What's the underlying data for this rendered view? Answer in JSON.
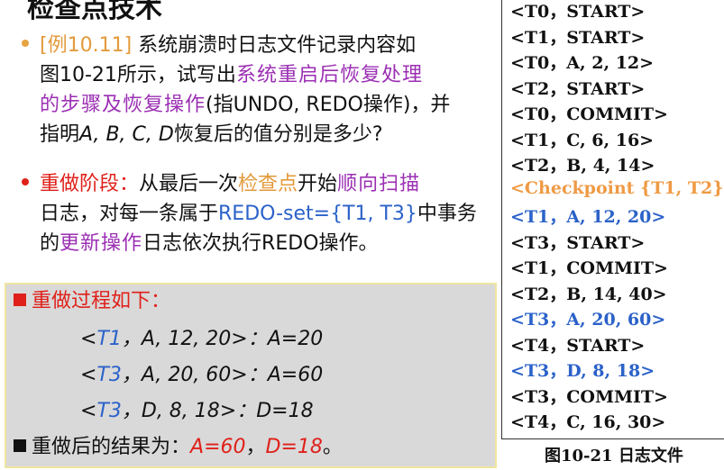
{
  "title": "检查点技术",
  "bullet1": {
    "tag": "[例10.11]",
    "line1": " 系统崩溃时日志文件记录内容如",
    "line2a": "图10-21所示，试写出",
    "line2b": "系统重启后恢复处理",
    "line3a": "的步骤及恢复操作",
    "line3b": "(指UNDO, REDO操作)，并",
    "line4a": "指明",
    "line4b": "A, B, C, D",
    "line4c": "恢复后的值分别是多少?"
  },
  "bullet2": {
    "phase": "重做阶段：",
    "l1a": "从最后一次",
    "l1b": "检查点",
    "l1c": "开始",
    "l1d": "顺向扫描",
    "l2a": "日志，对每一条属于",
    "l2b": "REDO-set={T1, T3}",
    "l2c": "中事务",
    "l3a": "的",
    "l3b": "更新操作",
    "l3c": "日志依次执行REDO操作。"
  },
  "redo_box": {
    "heading": "重做过程如下：",
    "steps": [
      {
        "tx": "T1",
        "rest": "，A, 12, 20>：",
        "result": "A=20"
      },
      {
        "tx": "T3",
        "rest": "，A, 20, 60>：",
        "result": "A=60"
      },
      {
        "tx": "T3",
        "rest": "，D, 8, 18>：",
        "result": "D=18"
      }
    ],
    "result_label": "重做后的结果为：",
    "result_a": "A=60",
    "result_sep": "，",
    "result_d": "D=18",
    "result_end": "。"
  },
  "log": [
    {
      "text": "<T0，START>",
      "color": "black"
    },
    {
      "text": "<T1，START>",
      "color": "black"
    },
    {
      "text": "<T0，A, 2, 12>",
      "color": "black"
    },
    {
      "text": "<T2，START>",
      "color": "black"
    },
    {
      "text": "<T0，COMMIT>",
      "color": "black"
    },
    {
      "text": "<T1，C, 6, 16>",
      "color": "black"
    },
    {
      "text": "<T2，B, 4, 14>",
      "color": "black"
    },
    {
      "text": "<Checkpoint {T1, T2}>",
      "color": "orange"
    },
    {
      "text": "<T1，A, 12, 20>",
      "color": "blue"
    },
    {
      "text": "<T3，START>",
      "color": "black"
    },
    {
      "text": "<T1，COMMIT>",
      "color": "black"
    },
    {
      "text": "<T2，B, 14, 40>",
      "color": "black"
    },
    {
      "text": "<T3，A, 20, 60>",
      "color": "blue"
    },
    {
      "text": "<T4，START>",
      "color": "black"
    },
    {
      "text": "<T3，D, 8, 18>",
      "color": "blue"
    },
    {
      "text": "<T3，COMMIT>",
      "color": "black"
    },
    {
      "text": "<T4，C, 16, 30>",
      "color": "black"
    }
  ],
  "caption": "图10-21  日志文件",
  "colors": {
    "accent_orange": "#e39a3b",
    "red": "#e0201a",
    "blue": "#2b62c9",
    "purple": "#9b2fb3",
    "box_bg": "#d9d9d9"
  }
}
